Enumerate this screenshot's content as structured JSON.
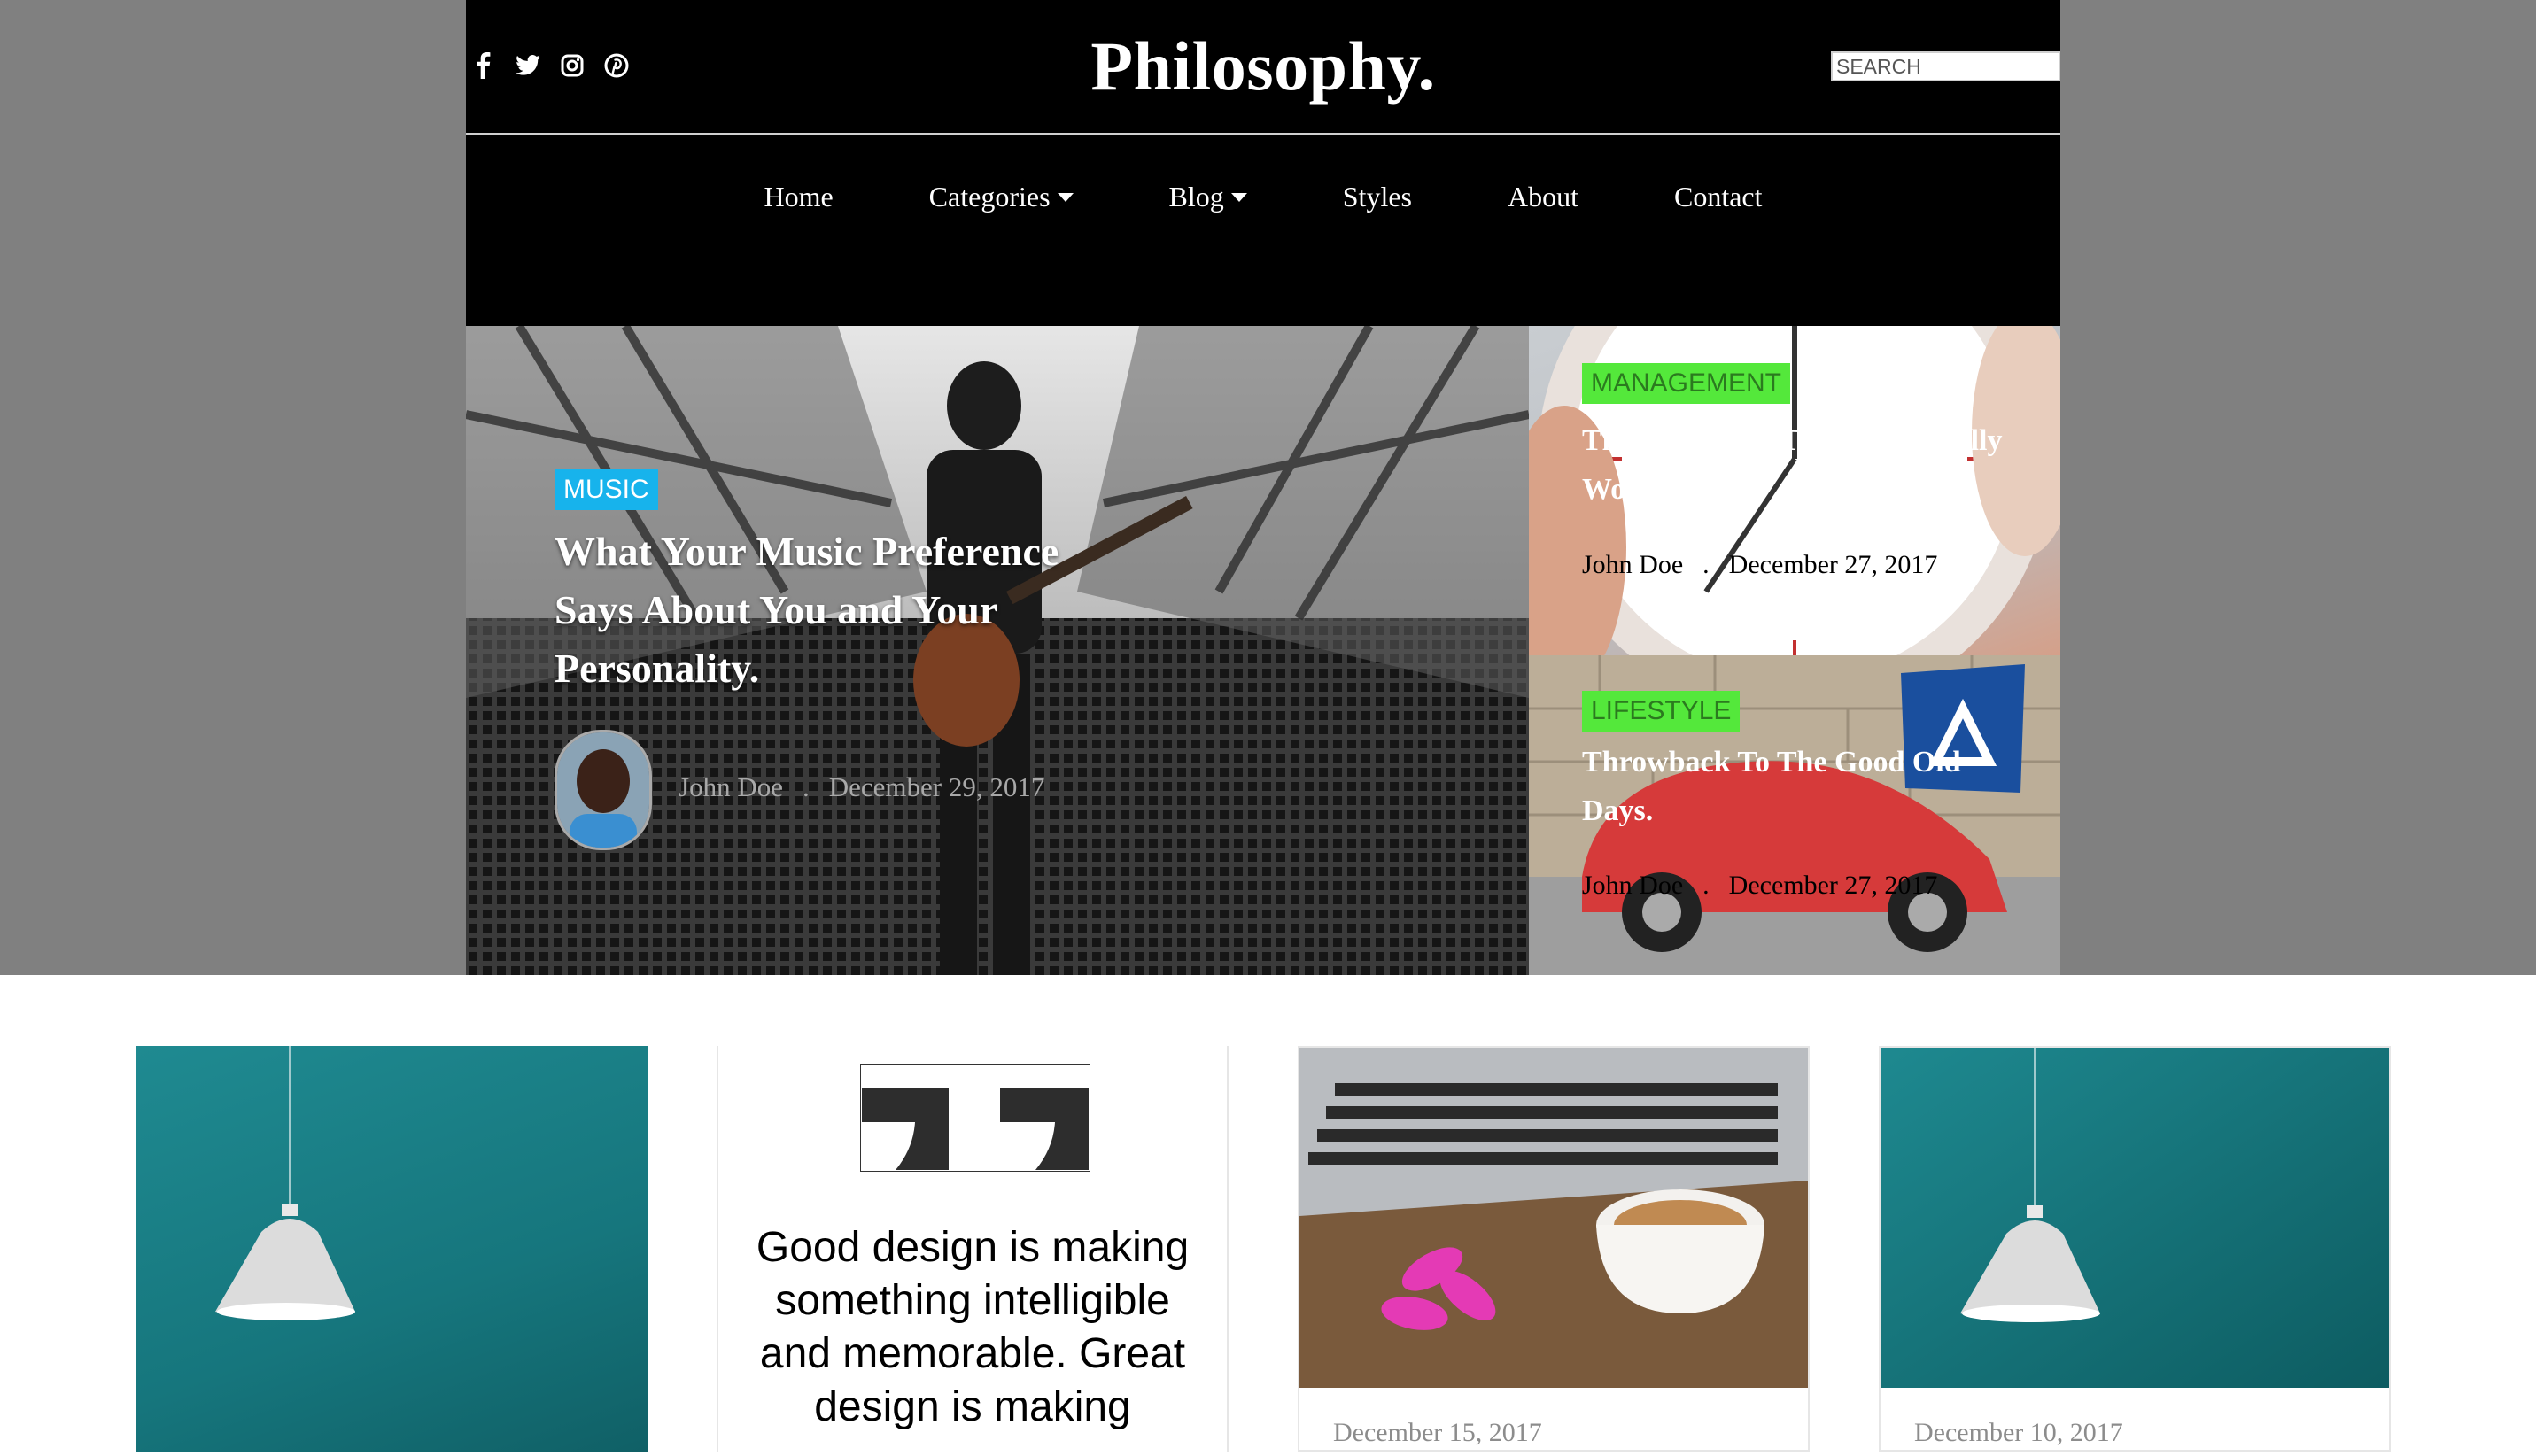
{
  "site": {
    "title": "Philosophy."
  },
  "search": {
    "placeholder": "SEARCH"
  },
  "social": [
    "facebook-icon",
    "twitter-icon",
    "instagram-icon",
    "pinterest-icon"
  ],
  "nav": {
    "items": [
      {
        "label": "Home",
        "dropdown": false
      },
      {
        "label": "Categories",
        "dropdown": true
      },
      {
        "label": "Blog",
        "dropdown": true
      },
      {
        "label": "Styles",
        "dropdown": false
      },
      {
        "label": "About",
        "dropdown": false
      },
      {
        "label": "Contact",
        "dropdown": false
      }
    ]
  },
  "hero": {
    "tag": "MUSIC",
    "title": "What Your Music Preference Says About You and Your Personality.",
    "author": "John Doe",
    "date": "December 29, 2017"
  },
  "side_posts": [
    {
      "tag": "MANAGEMENT",
      "title": "The Pomodoro Technique Really Works.",
      "author": "John Doe",
      "date": "December 27, 2017"
    },
    {
      "tag": "LIFESTYLE",
      "title": "Throwback To The Good Old Days.",
      "author": "John Doe",
      "date": "December 27, 2017"
    }
  ],
  "grid": {
    "quote": "Good design is making something intelligible and memorable. Great design is making",
    "dates": [
      "December 15, 2017",
      "December 10, 2017"
    ]
  },
  "colors": {
    "music_tag": "#17b3ec",
    "category_tag": "#54e83b",
    "header_bg": "#000000",
    "page_band": "#808080"
  }
}
